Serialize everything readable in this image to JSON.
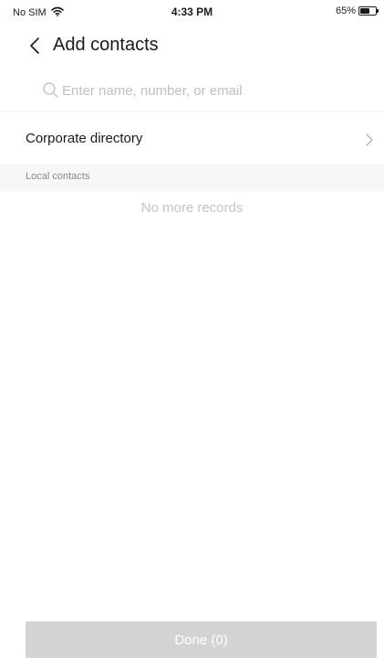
{
  "status_bar": {
    "carrier": "No SIM",
    "time": "4:33 PM",
    "battery": "65%",
    "battery_level": 0.65,
    "wifi_icon": "wifi-icon"
  },
  "header": {
    "back_icon": "chevron-left-icon",
    "title": "Add contacts"
  },
  "search": {
    "icon": "search-icon",
    "placeholder": "Enter name, number, or email",
    "value": ""
  },
  "directory": {
    "label": "Corporate directory",
    "icon": "chevron-right-icon"
  },
  "local_section": {
    "label": "Local contacts",
    "empty_text": "No more records"
  },
  "footer": {
    "done_label": "Done (0)"
  },
  "colors": {
    "text": "#1a1a1a",
    "placeholder": "#c0c0c0",
    "section_bg": "#f7f7f7",
    "disabled_button": "#d3d3d3"
  }
}
